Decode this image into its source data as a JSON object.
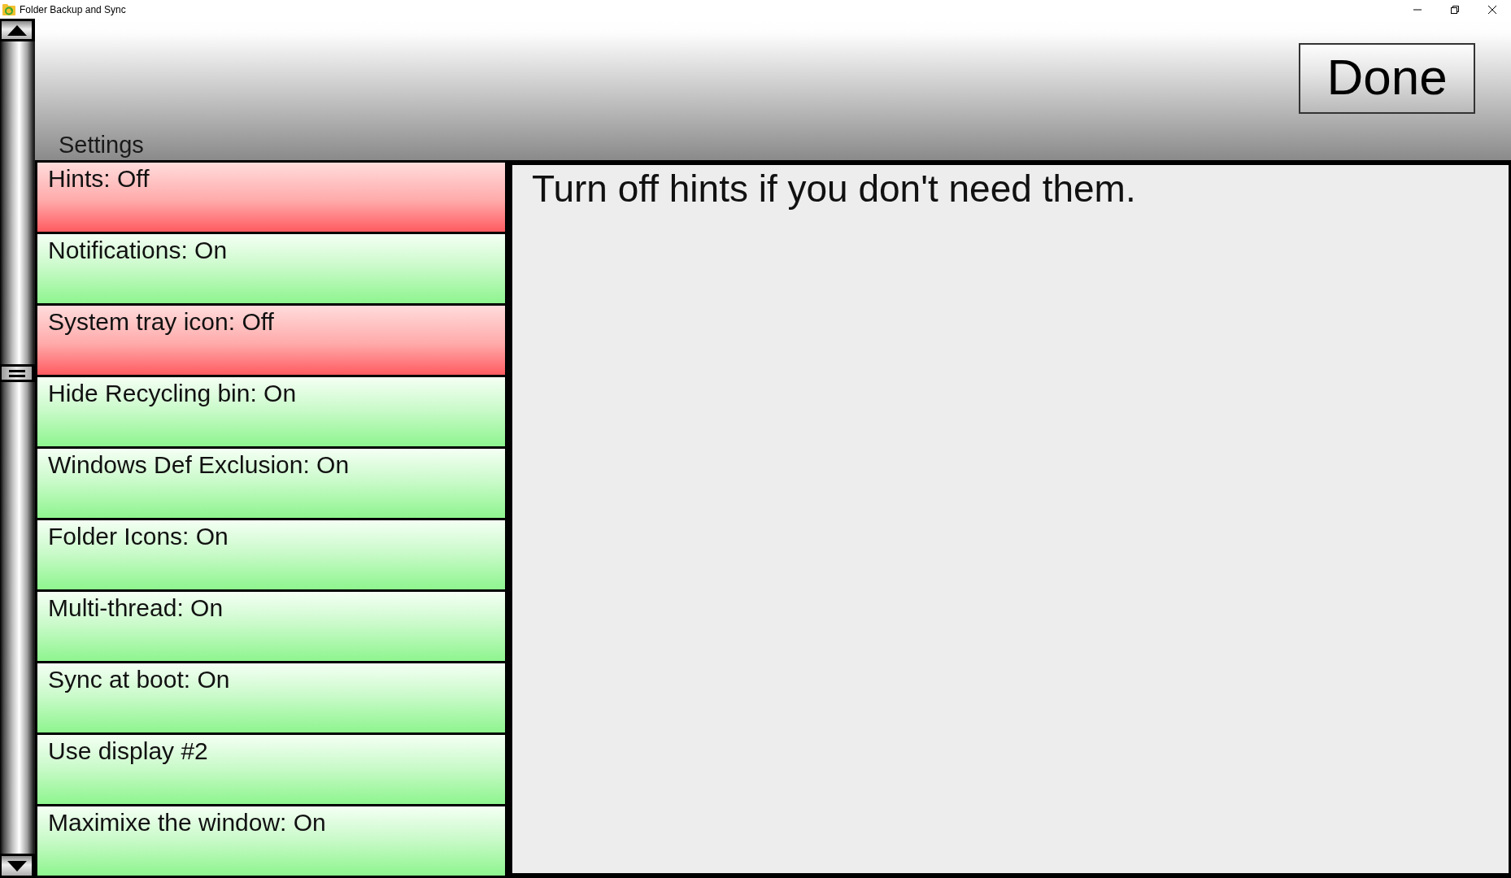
{
  "window": {
    "title": "Folder Backup and Sync"
  },
  "header": {
    "button": "Done",
    "section_title": "Settings"
  },
  "settings": [
    {
      "label": "Hints: Off",
      "on": false
    },
    {
      "label": "Notifications: On",
      "on": true
    },
    {
      "label": "System tray icon: Off",
      "on": false
    },
    {
      "label": "Hide Recycling bin: On",
      "on": true
    },
    {
      "label": "Windows Def Exclusion: On",
      "on": true
    },
    {
      "label": "Folder Icons: On",
      "on": true
    },
    {
      "label": "Multi-thread: On",
      "on": true
    },
    {
      "label": "Sync at boot: On",
      "on": true
    },
    {
      "label": "Use display #2",
      "on": true
    },
    {
      "label": "Maximixe the window: On",
      "on": true
    }
  ],
  "hint_panel": {
    "text": "Turn off hints if you don't need them."
  }
}
